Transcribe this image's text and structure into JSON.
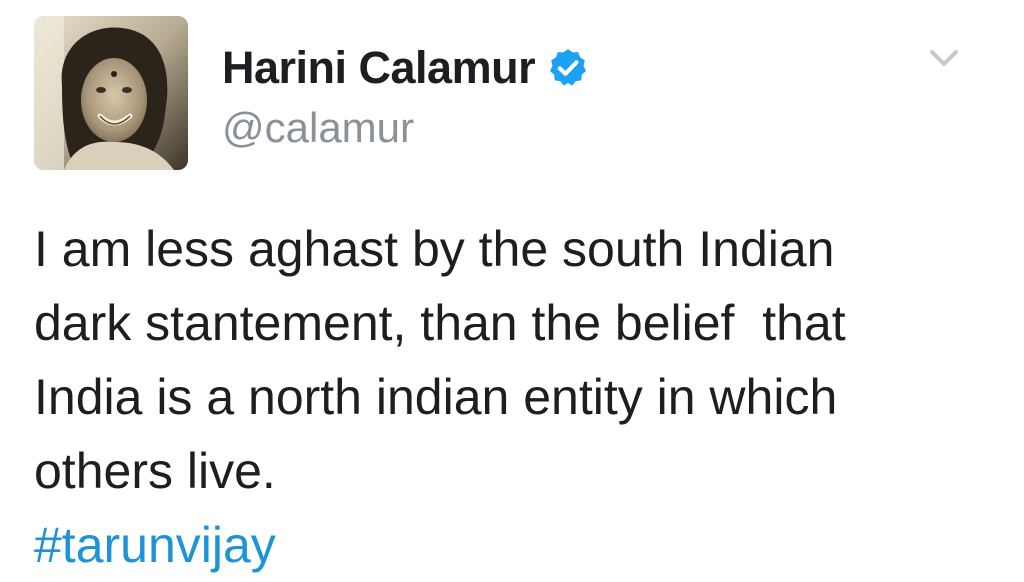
{
  "author": {
    "display_name": "Harini Calamur",
    "handle": "@calamur",
    "verified": true,
    "avatar_icon": "profile-photo"
  },
  "menu": {
    "icon": "chevron-down-icon"
  },
  "tweet": {
    "lines": [
      "I am less aghast by the south Indian",
      "dark stantement, than the belief  that",
      "India is a north indian entity in which",
      "others live."
    ],
    "hashtag": "#tarunvijay"
  },
  "colors": {
    "verified_badge": "#1da1f2",
    "hashtag": "#1e94d6",
    "handle": "#8a9199",
    "text": "#1c1e22"
  }
}
